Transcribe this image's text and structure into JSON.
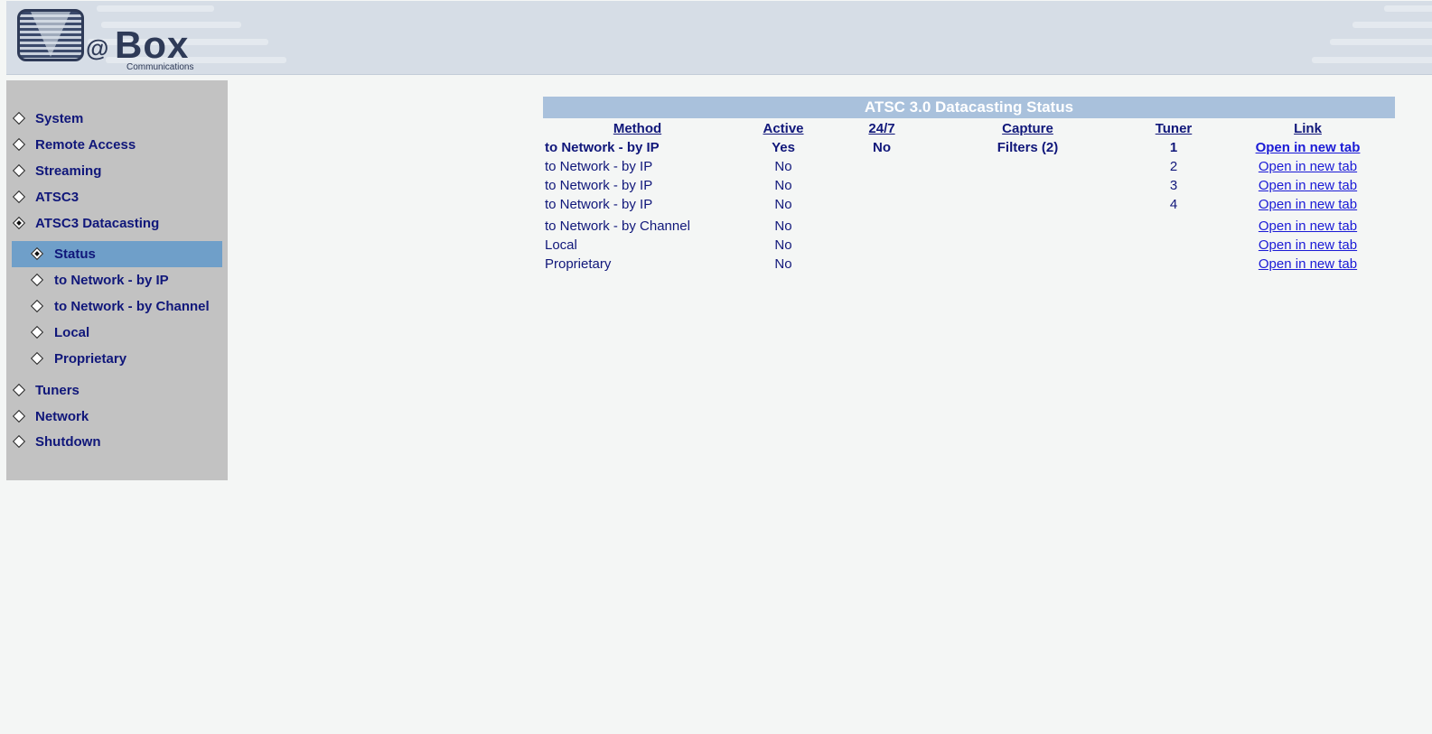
{
  "header": {
    "logo_at": "@",
    "logo_box": "Box",
    "logo_communications": "Communications"
  },
  "sidebar": {
    "items": [
      {
        "label": "System",
        "icon": "diamond-icon",
        "level": 1
      },
      {
        "label": "Remote Access",
        "icon": "diamond-icon",
        "level": 1
      },
      {
        "label": "Streaming",
        "icon": "diamond-icon",
        "level": 1
      },
      {
        "label": "ATSC3",
        "icon": "diamond-icon",
        "level": 1
      },
      {
        "label": "ATSC3 Datacasting",
        "icon": "diamond-filled-icon",
        "level": 1,
        "expanded": true
      },
      {
        "label": "Status",
        "icon": "diamond-filled-icon",
        "level": 2,
        "selected": true
      },
      {
        "label": "to Network - by IP",
        "icon": "diamond-icon",
        "level": 2
      },
      {
        "label": "to Network - by Channel",
        "icon": "diamond-icon",
        "level": 2
      },
      {
        "label": "Local",
        "icon": "diamond-icon",
        "level": 2
      },
      {
        "label": "Proprietary",
        "icon": "diamond-icon",
        "level": 2
      },
      {
        "label": "Tuners",
        "icon": "diamond-icon",
        "level": 1
      },
      {
        "label": "Network",
        "icon": "diamond-icon",
        "level": 1
      },
      {
        "label": "Shutdown",
        "icon": "diamond-icon",
        "level": 1
      }
    ]
  },
  "main": {
    "title": "ATSC 3.0 Datacasting Status",
    "columns": [
      "Method",
      "Active",
      "24/7",
      "Capture",
      "Tuner",
      "Link"
    ],
    "rows": [
      {
        "method": "to Network - by IP",
        "active": "Yes",
        "always": "No",
        "capture": "Filters (2)",
        "tuner": "1",
        "link": "Open in new tab",
        "bold": true
      },
      {
        "method": "to Network - by IP",
        "active": "No",
        "always": "",
        "capture": "",
        "tuner": "2",
        "link": "Open in new tab"
      },
      {
        "method": "to Network - by IP",
        "active": "No",
        "always": "",
        "capture": "",
        "tuner": "3",
        "link": "Open in new tab"
      },
      {
        "method": "to Network - by IP",
        "active": "No",
        "always": "",
        "capture": "",
        "tuner": "4",
        "link": "Open in new tab"
      },
      {
        "method": "to Network - by Channel",
        "active": "No",
        "always": "",
        "capture": "",
        "tuner": "",
        "link": "Open in new tab"
      },
      {
        "method": "Local",
        "active": "No",
        "always": "",
        "capture": "",
        "tuner": "",
        "link": "Open in new tab"
      },
      {
        "method": "Proprietary",
        "active": "No",
        "always": "",
        "capture": "",
        "tuner": "",
        "link": "Open in new tab"
      }
    ]
  },
  "colors": {
    "nav_text": "#10177a",
    "selected_bg": "#6f9fc9",
    "title_bar": "#a9c1dc",
    "link": "#1a1ad6"
  }
}
